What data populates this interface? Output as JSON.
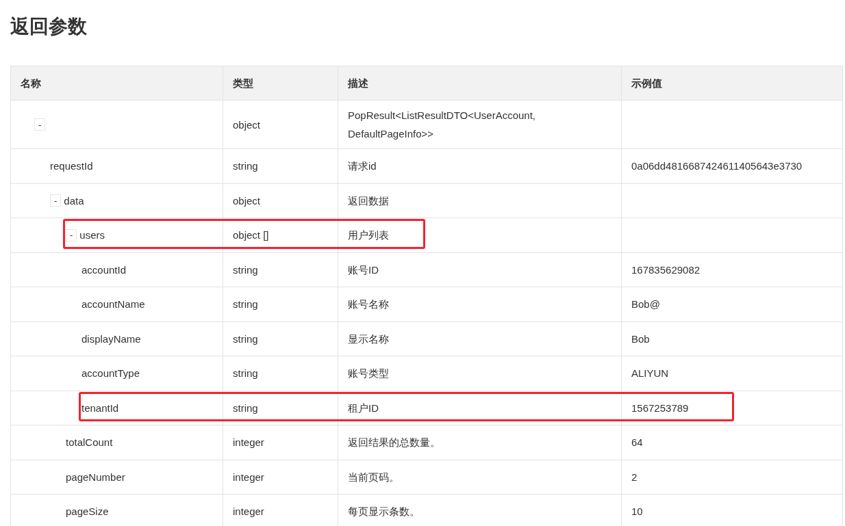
{
  "title": "返回参数",
  "table": {
    "columns": [
      "名称",
      "类型",
      "描述",
      "示例值"
    ],
    "rows": [
      {
        "toggle": "-",
        "type": "object",
        "description": "PopResult<ListResultDTO<UserAccount, DefaultPageInfo>>",
        "expanded": true,
        "children": [
          {
            "name": "requestId",
            "type": "string",
            "description": "请求id",
            "example": "0a06dd4816687424611405643e3730"
          },
          {
            "toggle": "-",
            "name": "data",
            "type": "object",
            "description": "返回数据",
            "expanded": true,
            "children": [
              {
                "toggle": "-",
                "name": "users",
                "type": "object []",
                "description": "用户列表",
                "expanded": true,
                "highlighted": true,
                "children": [
                  {
                    "name": "accountId",
                    "type": "string",
                    "description": "账号ID",
                    "example": "167835629082"
                  },
                  {
                    "name": "accountName",
                    "type": "string",
                    "description": "账号名称",
                    "example": "Bob@"
                  },
                  {
                    "name": "displayName",
                    "type": "string",
                    "description": "显示名称",
                    "example": "Bob"
                  },
                  {
                    "name": "accountType",
                    "type": "string",
                    "description": "账号类型",
                    "example": "ALIYUN"
                  },
                  {
                    "name": "tenantId",
                    "type": "string",
                    "description": "租户ID",
                    "example": "1567253789",
                    "highlighted": true
                  }
                ]
              },
              {
                "name": "totalCount",
                "type": "integer",
                "description": "返回结果的总数量。",
                "example": "64"
              },
              {
                "name": "pageNumber",
                "type": "integer",
                "description": "当前页码。",
                "example": "2"
              },
              {
                "name": "pageSize",
                "type": "integer",
                "description": "每页显示条数。",
                "example": "10"
              }
            ]
          }
        ]
      }
    ]
  }
}
